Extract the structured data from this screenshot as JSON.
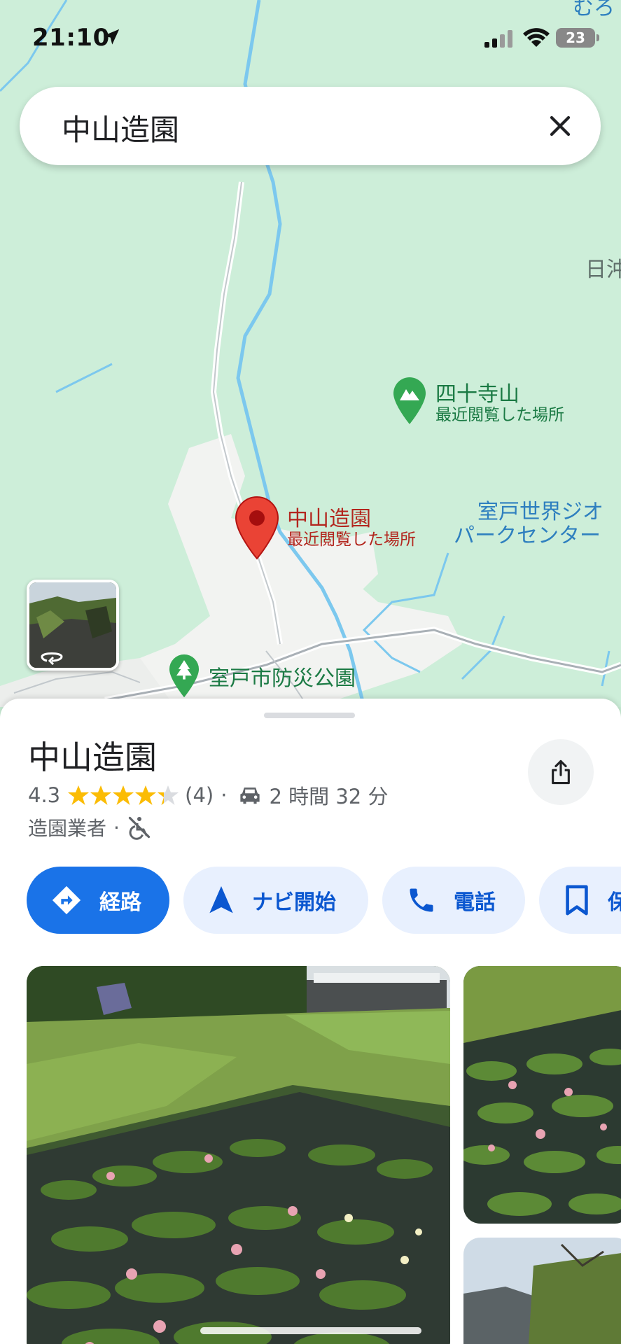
{
  "status_bar": {
    "time": "21:10",
    "battery": "23"
  },
  "search": {
    "query": "中山造園"
  },
  "map": {
    "labels": {
      "muro_partial": "むろ",
      "hinoki_partial": "日沖",
      "shijuji_name": "四十寺山",
      "shijuji_sub": "最近閲覧した場所",
      "nakayama_name": "中山造園",
      "nakayama_sub": "最近閲覧した場所",
      "geopark_line1": "室戸世界ジオ",
      "geopark_line2": "パークセンター",
      "bousai_park": "室戸市防災公園"
    },
    "colors": {
      "land": "#cdeed9",
      "water": "#7cc8ee",
      "urban": "#f2f3f1",
      "pin": "#ea4335",
      "park_marker": "#34a853"
    }
  },
  "place": {
    "title": "中山造園",
    "rating": "4.3",
    "rating_value": 4.3,
    "review_count": "(4)",
    "separator": "·",
    "drive_time": "2 時間 32 分",
    "category": "造園業者"
  },
  "actions": {
    "route": "経路",
    "navi": "ナビ開始",
    "call": "電話",
    "save": "保"
  },
  "icons": {
    "share": "share-icon",
    "car": "car-icon",
    "accessibility": "not-accessible-icon",
    "route": "directions-icon",
    "navi": "navigation-arrow-icon",
    "call": "phone-icon",
    "save": "bookmark-icon"
  }
}
